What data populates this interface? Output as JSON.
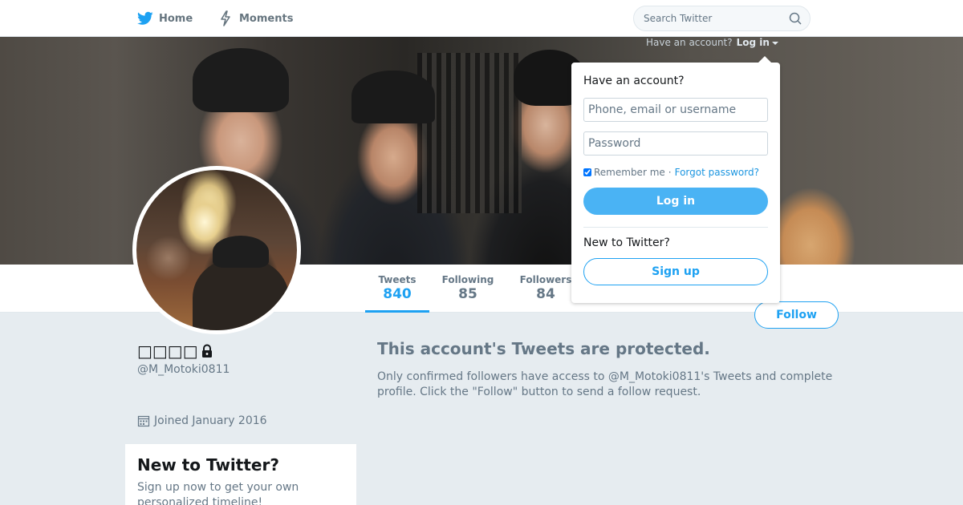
{
  "colors": {
    "accent": "#1da1f2",
    "login_button": "#4ab3f4",
    "page_background": "#e6ecf0",
    "muted_text": "#657786"
  },
  "nav": {
    "home_label": "Home",
    "home_icon": "twitter-bird-icon",
    "moments_label": "Moments",
    "moments_icon": "lightning-icon",
    "search_placeholder": "Search Twitter",
    "search_icon": "search-icon"
  },
  "account_prompt": {
    "text": "Have an account?",
    "login_label": "Log in"
  },
  "stats": [
    {
      "label": "Tweets",
      "value": "840"
    },
    {
      "label": "Following",
      "value": "85"
    },
    {
      "label": "Followers",
      "value": "84"
    }
  ],
  "profile": {
    "name": "□□□□",
    "handle": "@M_Motoki0811",
    "joined": "Joined January 2016",
    "lock_icon": "lock-icon",
    "calendar_icon": "calendar-icon"
  },
  "follow_button_label": "Follow",
  "protected": {
    "title": "This account's Tweets are protected.",
    "text": "Only confirmed followers have access to @M_Motoki0811's Tweets and complete profile. Click the \"Follow\" button to send a follow request."
  },
  "signup_card": {
    "title": "New to Twitter?",
    "text": "Sign up now to get your own personalized timeline!"
  },
  "login_dropdown": {
    "title": "Have an account?",
    "username_placeholder": "Phone, email or username",
    "password_placeholder": "Password",
    "remember_label": "Remember me",
    "separator": "·",
    "forgot_label": "Forgot password?",
    "login_button": "Log in",
    "new_label": "New to Twitter?",
    "signup_button": "Sign up"
  }
}
